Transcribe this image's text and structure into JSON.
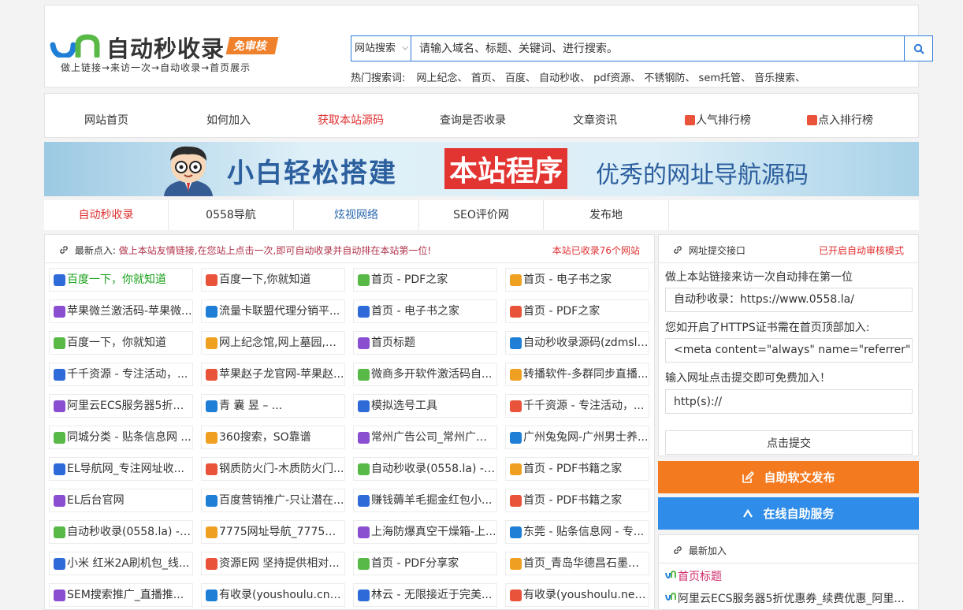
{
  "brand": {
    "title": "自动秒收录",
    "tag": "免审核",
    "subtitle": "做上链接→来访一次→自动收录→首页展示"
  },
  "search": {
    "select_value": "网站搜索",
    "placeholder": "请输入域名、标题、关键词、进行搜索。",
    "hot_label": "热门搜索词:",
    "hot_terms": [
      "网上纪念、",
      "首页、",
      "百度、",
      "自动秒收、",
      "pdf资源、",
      "不锈钢防、",
      "sem托管、",
      "音乐搜索、"
    ]
  },
  "nav": [
    "网站首页",
    "如何加入",
    "获取本站源码",
    "查询是否收录",
    "文章资讯",
    "人气排行榜",
    "点入排行榜"
  ],
  "banner": {
    "text1": "小白轻松搭建",
    "text2": "本站程序",
    "text3": "优秀的网址导航源码"
  },
  "tabs": [
    "自动秒收录",
    "0558导航",
    "炫视网络",
    "SEO评价网",
    "发布地"
  ],
  "main": {
    "head_label": "最新点入:",
    "head_text": "做上本站友情链接,在您站上点击一次,即可自动收录并自动排在本站第一位!",
    "count_text": "本站已收录76个网站",
    "rows": [
      [
        "百度一下，你就知道",
        "百度一下,你就知道",
        "首页 - PDF之家",
        "首页 - 电子书之家"
      ],
      [
        "苹果微兰激活码-苹果微...",
        "流量卡联盟代理分销平...",
        "首页 - 电子书之家",
        "首页 - PDF之家"
      ],
      [
        "百度一下，你就知道",
        "网上纪念馆,网上墓园,网...",
        "首页标题",
        "自动秒收录源码(zdmsl...."
      ],
      [
        "千千资源 - 专注活动，...",
        "苹果赵子龙官网-苹果赵...",
        "微商多开软件激活码自...",
        "转播软件-多群同步直播..."
      ],
      [
        "阿里云ECS服务器5折优...",
        "青 囊 昱 – ...",
        "模拟选号工具",
        "千千资源 - 专注活动，..."
      ],
      [
        "同城分类 - 贴条信息网 ...",
        "360搜索，SO靠谱",
        "常州广告公司_常州广告...",
        "广州兔兔网-广州男士养..."
      ],
      [
        "EL导航网_专注网址收...",
        "钢质防火门-木质防火门...",
        "自动秒收录(0558.la) - ...",
        "首页 - PDF书籍之家"
      ],
      [
        "EL后台官网",
        "百度营销推广-只让潜在...",
        "赚钱薅羊毛掘金红包小...",
        "首页 - PDF书籍之家"
      ],
      [
        "自动秒收录(0558.la) - ...",
        "7775网址导航_7775网...",
        "上海防爆真空干燥箱-上...",
        "东莞 - 贴条信息网 - 专..."
      ],
      [
        "小米 红米2A刷机包_线...",
        "资源E网 坚持提供相对...",
        "首页 - PDF分享家",
        "首页_青岛华德昌石墨新..."
      ],
      [
        "SEM搜索推广_直播推...",
        "有收录(youshoulu.cn) -...",
        "林云 - 无限接近于完美...",
        "有收录(youshoulu.net) ..."
      ]
    ]
  },
  "side": {
    "head_label": "网址提交接口",
    "head_mode": "已开启自动审核模式",
    "line1": "做上本站链接来访一次自动排在第一位",
    "field1": "自动秒收录：https://www.0558.la/",
    "line2": "您如开启了HTTPS证书需在首页顶部加入:",
    "field2": "<meta content=\"always\" name=\"referrer\">",
    "line3": "输入网址点击提交即可免费加入！",
    "url_placeholder": "http(s)://",
    "submit_label": "点击提交"
  },
  "buttons": {
    "publish": "自助软文发布",
    "service": "在线自助服务"
  },
  "latest": {
    "head_label": "最新加入",
    "items": [
      "首页标题",
      "阿里云ECS服务器5折优惠券_续费优惠_阿里..."
    ]
  },
  "colors": {
    "accent_blue": "#2f7ad7",
    "accent_red": "#e03030",
    "orange": "#f47a1f",
    "blue_button": "#2f8ce8",
    "green_link": "#1aa01a"
  }
}
